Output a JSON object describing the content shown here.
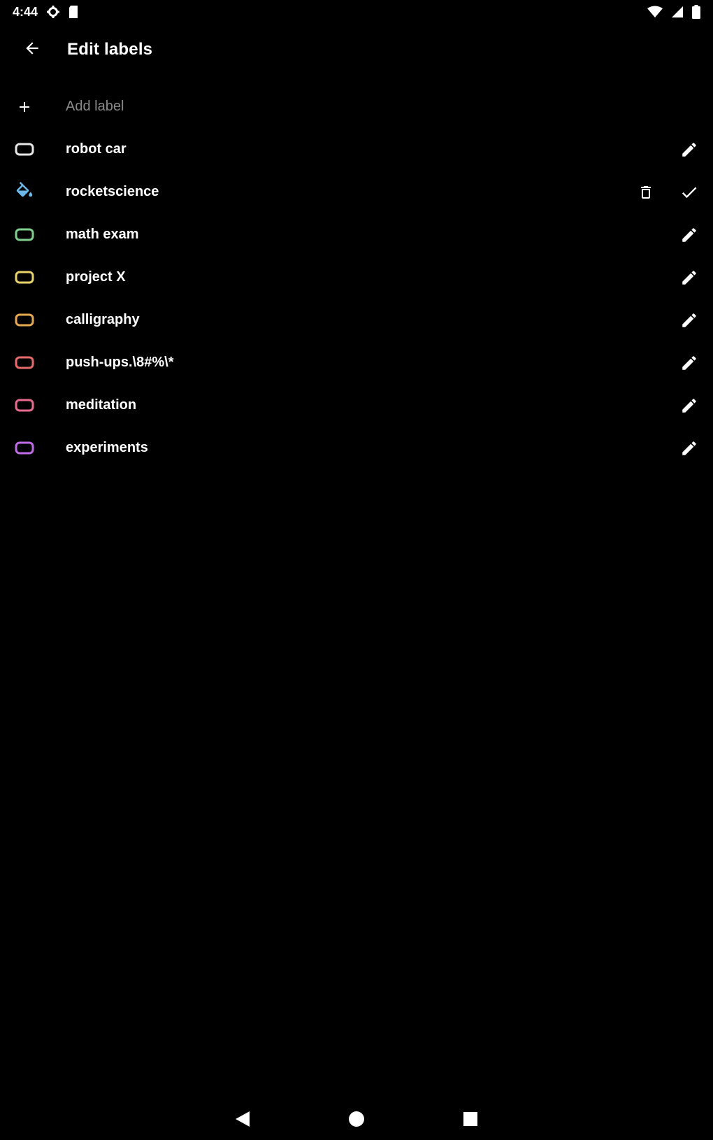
{
  "status_bar": {
    "time": "4:44",
    "left_icons": [
      "settings-icon",
      "storage-icon"
    ],
    "right_icons": [
      "wifi-icon",
      "cell-signal-icon",
      "battery-icon"
    ]
  },
  "app_bar": {
    "back_icon": "arrow-back-icon",
    "title": "Edit labels"
  },
  "add_label": {
    "icon": "plus-icon",
    "placeholder": "Add label"
  },
  "labels": [
    {
      "name": "robot car",
      "color": "#e8e8e8",
      "icon": "label-outline-icon",
      "state": "view"
    },
    {
      "name": "rocketscience",
      "color": "#6bb7e8",
      "icon": "label-colour-icon",
      "state": "editing"
    },
    {
      "name": "math exam",
      "color": "#7fd08f",
      "icon": "label-outline-icon",
      "state": "view"
    },
    {
      "name": "project X",
      "color": "#e8d36b",
      "icon": "label-outline-icon",
      "state": "view"
    },
    {
      "name": "calligraphy",
      "color": "#e8a84e",
      "icon": "label-outline-icon",
      "state": "view"
    },
    {
      "name": "push-ups.\\8#%\\*",
      "color": "#e86b6b",
      "icon": "label-outline-icon",
      "state": "view"
    },
    {
      "name": "meditation",
      "color": "#e86b8f",
      "icon": "label-outline-icon",
      "state": "view"
    },
    {
      "name": "experiments",
      "color": "#c06be8",
      "icon": "label-outline-icon",
      "state": "view"
    }
  ],
  "row_actions": {
    "edit_icon": "pencil-icon",
    "delete_icon": "trash-icon",
    "confirm_icon": "check-icon"
  },
  "nav_bar": {
    "back_icon": "nav-back-triangle-icon",
    "home_icon": "nav-home-circle-icon",
    "recents_icon": "nav-recents-square-icon"
  },
  "colors": {
    "background": "#000000",
    "text": "#ffffff",
    "placeholder": "#8a8a8a"
  }
}
